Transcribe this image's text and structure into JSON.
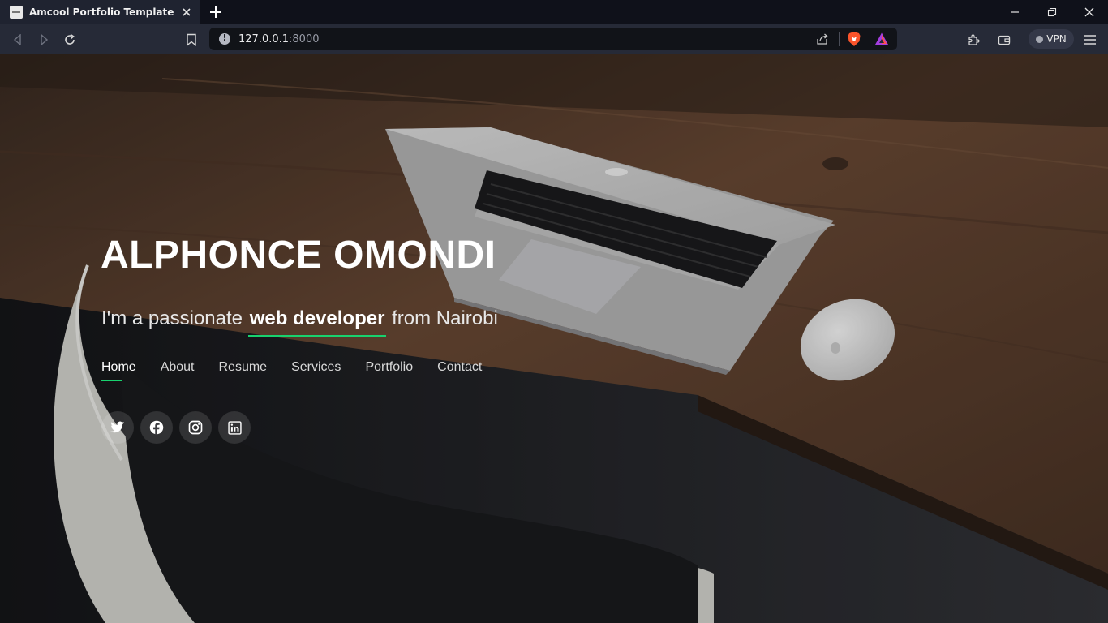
{
  "browser": {
    "tab_title": "Amcool Portfolio Template",
    "url_host": "127.0.0.1",
    "url_port": ":8000",
    "vpn_label": "VPN",
    "icons": [
      "back-icon",
      "forward-icon",
      "reload-icon",
      "bookmark-icon",
      "share-icon",
      "brave-shields-icon",
      "brave-rewards-icon",
      "extensions-icon",
      "wallet-icon",
      "menu-icon",
      "minimize-icon",
      "maximize-icon",
      "close-icon"
    ]
  },
  "hero": {
    "name": "ALPHONCE OMONDI",
    "tagline_prefix": "I'm a passionate ",
    "tagline_highlight": "web developer",
    "tagline_suffix": " from Nairobi",
    "accent_color": "#18d26e"
  },
  "menu": {
    "items": [
      {
        "label": "Home",
        "active": true
      },
      {
        "label": "About"
      },
      {
        "label": "Resume"
      },
      {
        "label": "Services"
      },
      {
        "label": "Portfolio"
      },
      {
        "label": "Contact"
      }
    ]
  },
  "socials": [
    "twitter-icon",
    "facebook-icon",
    "instagram-icon",
    "linkedin-icon"
  ]
}
